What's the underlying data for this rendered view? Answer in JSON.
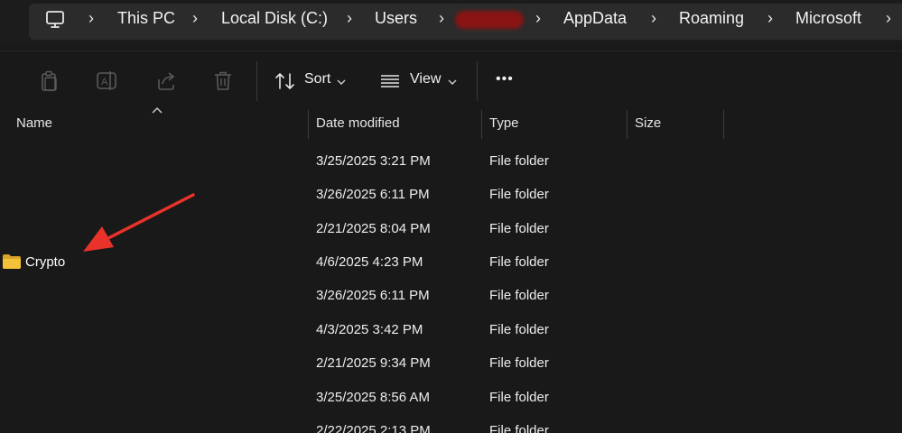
{
  "breadcrumb": {
    "items": [
      "This PC",
      "Local Disk (C:)",
      "Users",
      "AppData",
      "Roaming",
      "Microsoft"
    ],
    "redacted_note": "",
    "root_icon": "computer-icon"
  },
  "toolbar": {
    "sort_label": "Sort",
    "view_label": "View",
    "more_label": "•••",
    "icons": [
      "copy-icon",
      "rename-icon",
      "share-icon",
      "delete-icon",
      "sort-icon",
      "view-icon"
    ]
  },
  "columns": {
    "name": "Name",
    "date": "Date modified",
    "type": "Type",
    "size": "Size"
  },
  "rows": [
    {
      "name": "",
      "date": "3/25/2025 3:21 PM",
      "type": "File folder"
    },
    {
      "name": "",
      "date": "3/26/2025 6:11 PM",
      "type": "File folder"
    },
    {
      "name": "",
      "date": "2/21/2025 8:04 PM",
      "type": "File folder"
    },
    {
      "name": "Crypto",
      "date": "4/6/2025 4:23 PM",
      "type": "File folder"
    },
    {
      "name": "",
      "date": "3/26/2025 6:11 PM",
      "type": "File folder"
    },
    {
      "name": "",
      "date": "4/3/2025 3:42 PM",
      "type": "File folder"
    },
    {
      "name": "",
      "date": "2/21/2025 9:34 PM",
      "type": "File folder"
    },
    {
      "name": "",
      "date": "3/25/2025 8:56 AM",
      "type": "File folder"
    },
    {
      "name": "",
      "date": "2/22/2025 2:13 PM",
      "type": "File folder"
    }
  ],
  "colors": {
    "background": "#191919",
    "annotation_arrow": "#e8322a",
    "redaction": "#8a1414",
    "folder": "#f3c13a"
  }
}
